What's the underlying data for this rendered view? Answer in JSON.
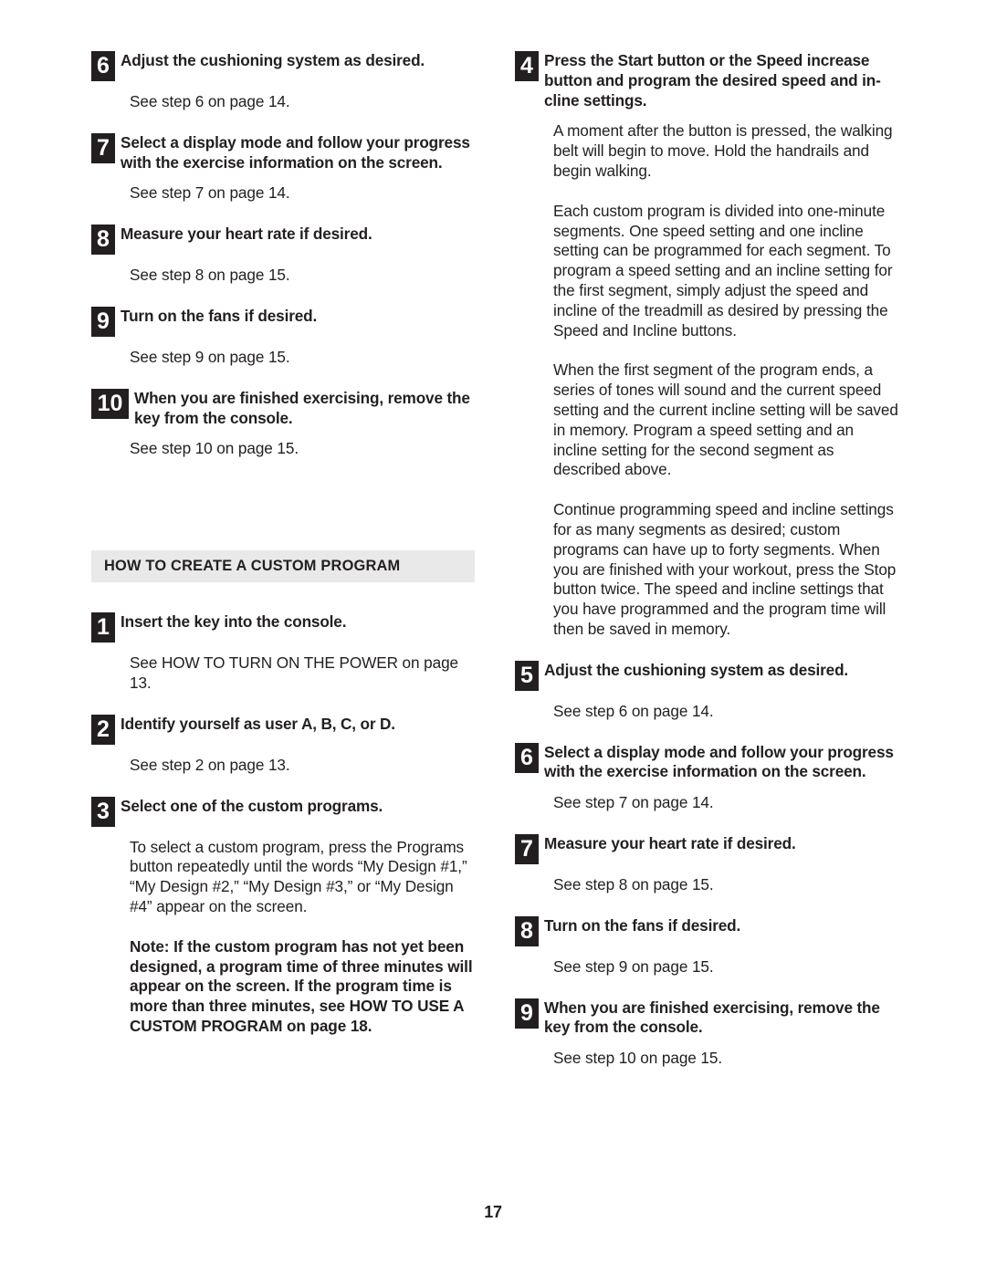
{
  "page": {
    "number": "17"
  },
  "left_column": {
    "blocks": [
      {
        "kind": "step",
        "number": "6",
        "title": "Adjust the cushioning system as desired.",
        "body": "See step 6 on page 14."
      },
      {
        "kind": "step",
        "number": "7",
        "title": "Select a display mode and follow your progress with the exercise information on the screen.",
        "body": "See step 7 on page 14."
      },
      {
        "kind": "step",
        "number": "8",
        "title": "Measure your heart rate if desired.",
        "body": "See step 8 on page 15."
      },
      {
        "kind": "step",
        "number": "9",
        "title": "Turn on the fans if desired.",
        "body": "See step 9 on page 15."
      },
      {
        "kind": "step",
        "number": "10",
        "title": "When you are finished exercising, remove the key from the console.",
        "body": "See step 10 on page 15."
      },
      {
        "kind": "heading",
        "text": "HOW TO CREATE A CUSTOM PROGRAM"
      },
      {
        "kind": "step",
        "number": "1",
        "title": "Insert the key into the console.",
        "body": "See HOW TO TURN ON THE POWER on page 13."
      },
      {
        "kind": "step",
        "number": "2",
        "title": "Identify yourself as user A, B, C, or D.",
        "body": "See step 2 on page 13."
      },
      {
        "kind": "step",
        "number": "3",
        "title": "Select one of the custom programs.",
        "body": "To select a custom program, press the Programs button repeatedly until the words “My Design #1,” “My Design #2,” “My Design #3,” or “My Design #4” appear on the screen.",
        "note": "Note: If the custom program has not yet been designed, a program time of three minutes will appear on the screen. If the program time is more than three minutes, see HOW TO USE A CUSTOM PROGRAM on page 18."
      }
    ]
  },
  "right_column": {
    "blocks": [
      {
        "kind": "step",
        "number": "4",
        "title": "Press the Start button or the Speed increase button and program the desired speed and in-cline settings.",
        "paragraphs": [
          "A moment after the button is pressed, the walking belt will begin to move. Hold the handrails and begin walking.",
          "Each custom program is divided into one-minute segments. One speed setting and one incline setting can be programmed for each segment. To program a speed setting and an incline setting for the first segment, simply adjust the speed and incline of the treadmill as desired by pressing the Speed and Incline buttons.",
          "When the first segment of the program ends, a series of tones will sound and the current speed setting and the current incline setting will be saved in memory. Program a speed setting and an incline setting for the second segment as described above.",
          "Continue programming speed and incline settings for as many segments as desired; custom programs can have up to forty segments. When you are finished with your workout, press the Stop button twice. The speed and incline settings that you have programmed and the program time will then be saved in memory."
        ]
      },
      {
        "kind": "step",
        "number": "5",
        "title": "Adjust the cushioning system as desired.",
        "body": "See step 6 on page 14."
      },
      {
        "kind": "step",
        "number": "6",
        "title": "Select a display mode and follow your progress with the exercise information on the screen.",
        "body": "See step 7 on page 14."
      },
      {
        "kind": "step",
        "number": "7",
        "title": "Measure your heart rate if desired.",
        "body": "See step 8 on page 15."
      },
      {
        "kind": "step",
        "number": "8",
        "title": "Turn on the fans if desired.",
        "body": "See step 9 on page 15."
      },
      {
        "kind": "step",
        "number": "9",
        "title": "When you are finished exercising, remove the key from the console.",
        "body": "See step 10 on page 15."
      }
    ]
  }
}
